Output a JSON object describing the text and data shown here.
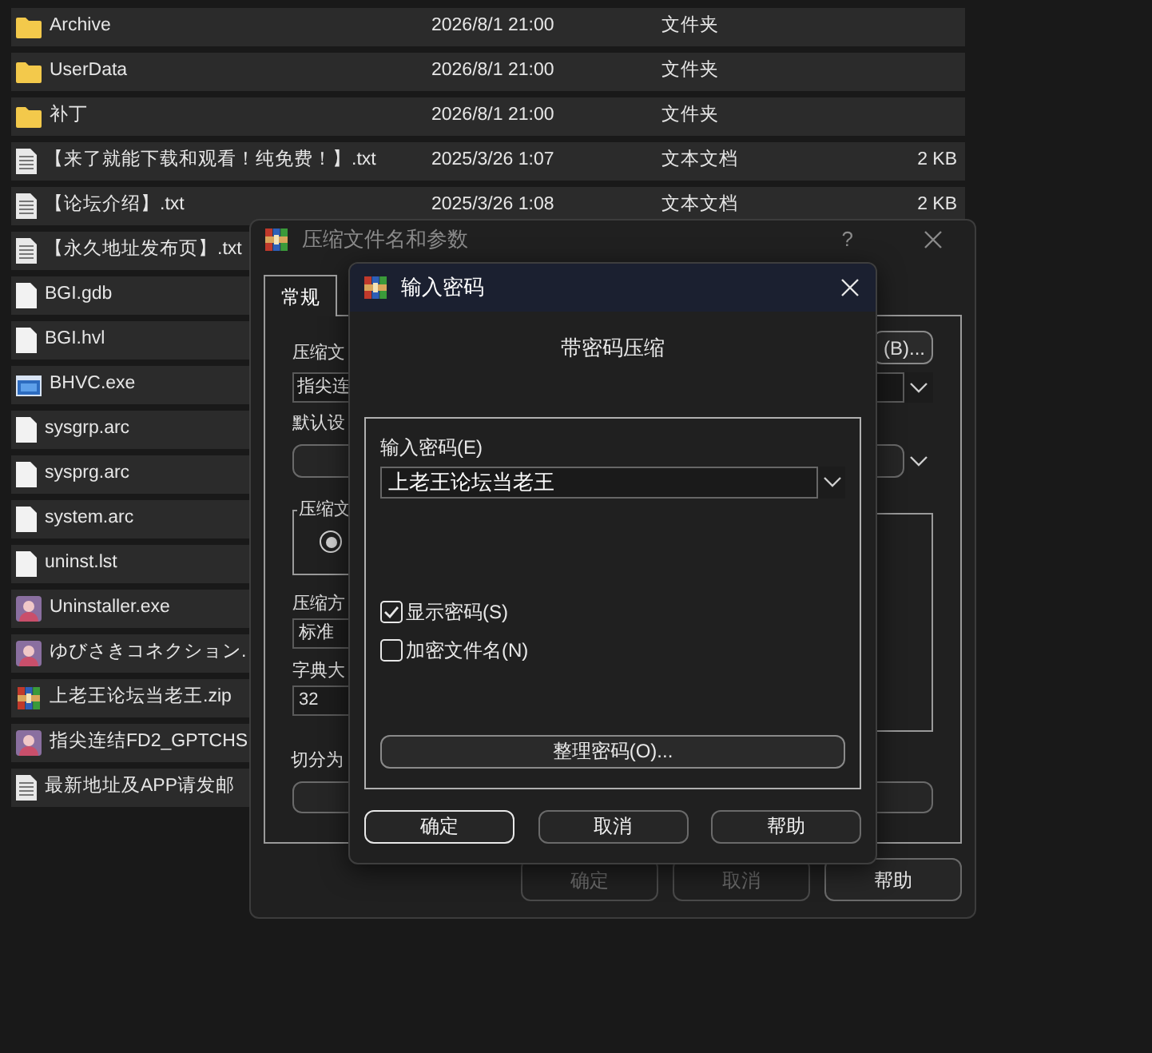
{
  "files": [
    {
      "kind": "folder",
      "name": "Archive",
      "date": "2026/8/1 21:00",
      "type": "文件夹"
    },
    {
      "kind": "folder",
      "name": "UserData",
      "date": "2026/8/1 21:00",
      "type": "文件夹"
    },
    {
      "kind": "folder",
      "name": "补丁",
      "date": "2026/8/1 21:00",
      "type": "文件夹"
    },
    {
      "kind": "text",
      "name": "【来了就能下载和观看！纯免费！】.txt",
      "date": "2025/3/26 1:07",
      "type": "文本文档",
      "size": "2 KB"
    },
    {
      "kind": "text",
      "name": "【论坛介绍】.txt",
      "date": "2025/3/26 1:08",
      "type": "文本文档",
      "size": "2 KB"
    },
    {
      "kind": "text",
      "name": "【永久地址发布页】.txt"
    },
    {
      "kind": "file",
      "name": "BGI.gdb"
    },
    {
      "kind": "file",
      "name": "BGI.hvl"
    },
    {
      "kind": "exe",
      "name": "BHVC.exe"
    },
    {
      "kind": "file",
      "name": "sysgrp.arc"
    },
    {
      "kind": "file",
      "name": "sysprg.arc"
    },
    {
      "kind": "file",
      "name": "system.arc"
    },
    {
      "kind": "file",
      "name": "uninst.lst"
    },
    {
      "kind": "app",
      "name": "Uninstaller.exe"
    },
    {
      "kind": "app",
      "name": "ゆびさきコネクション."
    },
    {
      "kind": "archive",
      "name": "上老王论坛当老王.zip"
    },
    {
      "kind": "app",
      "name": "指尖连结FD2_GPTCHS"
    },
    {
      "kind": "text",
      "name": "最新地址及APP请发邮"
    }
  ],
  "compress_dialog": {
    "title": "压缩文件名和参数",
    "help": "?",
    "tabs": [
      {
        "label": "常规",
        "selected": true
      }
    ],
    "archive_label": "压缩文",
    "browse_button": "(B)...",
    "archive_value": "指尖连",
    "profile_label": "默认设",
    "format_group_label": "压缩文",
    "format_radio_selected": true,
    "method_label": "压缩方",
    "method_value": "标准",
    "dict_label": "字典大",
    "dict_value": "32",
    "split_label": "切分为",
    "buttons": [
      {
        "label": "确定",
        "disabled": true
      },
      {
        "label": "取消",
        "disabled": true
      },
      {
        "label": "帮助",
        "disabled": false
      }
    ]
  },
  "password_dialog": {
    "title": "输入密码",
    "heading": "带密码压缩",
    "password_label": "输入密码(E)",
    "password_value": "上老王论坛当老王",
    "options": [
      {
        "label": "显示密码(S)",
        "checked": true
      },
      {
        "label": "加密文件名(N)",
        "checked": false
      }
    ],
    "organize_button": "整理密码(O)...",
    "buttons": [
      {
        "label": "确定",
        "focused": true
      },
      {
        "label": "取消",
        "focused": false
      },
      {
        "label": "帮助",
        "focused": false
      }
    ]
  }
}
